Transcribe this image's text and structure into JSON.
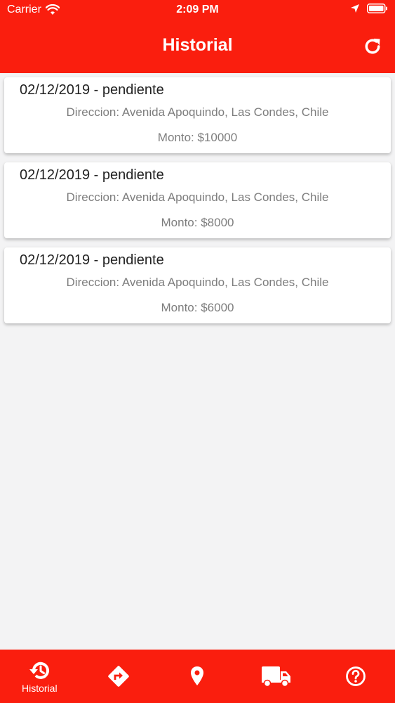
{
  "status_bar": {
    "carrier": "Carrier",
    "time": "2:09 PM"
  },
  "header": {
    "title": "Historial"
  },
  "orders": [
    {
      "title": "02/12/2019 - pendiente",
      "address": "Direccion: Avenida Apoquindo, Las Condes, Chile",
      "amount": "Monto: $10000"
    },
    {
      "title": "02/12/2019 - pendiente",
      "address": "Direccion: Avenida Apoquindo, Las Condes, Chile",
      "amount": "Monto: $8000"
    },
    {
      "title": "02/12/2019 - pendiente",
      "address": "Direccion: Avenida Apoquindo, Las Condes, Chile",
      "amount": "Monto: $6000"
    }
  ],
  "tabs": [
    {
      "label": "Historial",
      "icon": "history-icon",
      "active": true
    },
    {
      "label": "",
      "icon": "directions-icon"
    },
    {
      "label": "",
      "icon": "location-pin-icon"
    },
    {
      "label": "",
      "icon": "truck-icon"
    },
    {
      "label": "",
      "icon": "help-icon"
    }
  ],
  "colors": {
    "primary": "#fa1e0e",
    "background": "#f3f3f4",
    "card": "#ffffff",
    "muted_text": "#7d7d7d"
  }
}
